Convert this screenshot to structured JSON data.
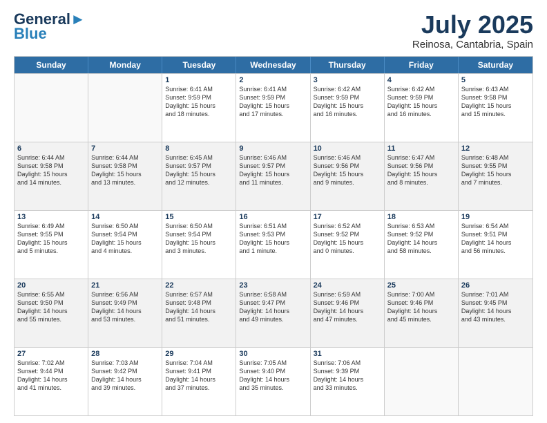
{
  "logo": {
    "line1": "General",
    "line2": "Blue"
  },
  "title": "July 2025",
  "location": "Reinosa, Cantabria, Spain",
  "weekdays": [
    "Sunday",
    "Monday",
    "Tuesday",
    "Wednesday",
    "Thursday",
    "Friday",
    "Saturday"
  ],
  "weeks": [
    [
      {
        "day": "",
        "info": "",
        "empty": true
      },
      {
        "day": "",
        "info": "",
        "empty": true
      },
      {
        "day": "1",
        "info": "Sunrise: 6:41 AM\nSunset: 9:59 PM\nDaylight: 15 hours\nand 18 minutes."
      },
      {
        "day": "2",
        "info": "Sunrise: 6:41 AM\nSunset: 9:59 PM\nDaylight: 15 hours\nand 17 minutes."
      },
      {
        "day": "3",
        "info": "Sunrise: 6:42 AM\nSunset: 9:59 PM\nDaylight: 15 hours\nand 16 minutes."
      },
      {
        "day": "4",
        "info": "Sunrise: 6:42 AM\nSunset: 9:59 PM\nDaylight: 15 hours\nand 16 minutes."
      },
      {
        "day": "5",
        "info": "Sunrise: 6:43 AM\nSunset: 9:58 PM\nDaylight: 15 hours\nand 15 minutes."
      }
    ],
    [
      {
        "day": "6",
        "info": "Sunrise: 6:44 AM\nSunset: 9:58 PM\nDaylight: 15 hours\nand 14 minutes."
      },
      {
        "day": "7",
        "info": "Sunrise: 6:44 AM\nSunset: 9:58 PM\nDaylight: 15 hours\nand 13 minutes."
      },
      {
        "day": "8",
        "info": "Sunrise: 6:45 AM\nSunset: 9:57 PM\nDaylight: 15 hours\nand 12 minutes."
      },
      {
        "day": "9",
        "info": "Sunrise: 6:46 AM\nSunset: 9:57 PM\nDaylight: 15 hours\nand 11 minutes."
      },
      {
        "day": "10",
        "info": "Sunrise: 6:46 AM\nSunset: 9:56 PM\nDaylight: 15 hours\nand 9 minutes."
      },
      {
        "day": "11",
        "info": "Sunrise: 6:47 AM\nSunset: 9:56 PM\nDaylight: 15 hours\nand 8 minutes."
      },
      {
        "day": "12",
        "info": "Sunrise: 6:48 AM\nSunset: 9:55 PM\nDaylight: 15 hours\nand 7 minutes."
      }
    ],
    [
      {
        "day": "13",
        "info": "Sunrise: 6:49 AM\nSunset: 9:55 PM\nDaylight: 15 hours\nand 5 minutes."
      },
      {
        "day": "14",
        "info": "Sunrise: 6:50 AM\nSunset: 9:54 PM\nDaylight: 15 hours\nand 4 minutes."
      },
      {
        "day": "15",
        "info": "Sunrise: 6:50 AM\nSunset: 9:54 PM\nDaylight: 15 hours\nand 3 minutes."
      },
      {
        "day": "16",
        "info": "Sunrise: 6:51 AM\nSunset: 9:53 PM\nDaylight: 15 hours\nand 1 minute."
      },
      {
        "day": "17",
        "info": "Sunrise: 6:52 AM\nSunset: 9:52 PM\nDaylight: 15 hours\nand 0 minutes."
      },
      {
        "day": "18",
        "info": "Sunrise: 6:53 AM\nSunset: 9:52 PM\nDaylight: 14 hours\nand 58 minutes."
      },
      {
        "day": "19",
        "info": "Sunrise: 6:54 AM\nSunset: 9:51 PM\nDaylight: 14 hours\nand 56 minutes."
      }
    ],
    [
      {
        "day": "20",
        "info": "Sunrise: 6:55 AM\nSunset: 9:50 PM\nDaylight: 14 hours\nand 55 minutes."
      },
      {
        "day": "21",
        "info": "Sunrise: 6:56 AM\nSunset: 9:49 PM\nDaylight: 14 hours\nand 53 minutes."
      },
      {
        "day": "22",
        "info": "Sunrise: 6:57 AM\nSunset: 9:48 PM\nDaylight: 14 hours\nand 51 minutes."
      },
      {
        "day": "23",
        "info": "Sunrise: 6:58 AM\nSunset: 9:47 PM\nDaylight: 14 hours\nand 49 minutes."
      },
      {
        "day": "24",
        "info": "Sunrise: 6:59 AM\nSunset: 9:46 PM\nDaylight: 14 hours\nand 47 minutes."
      },
      {
        "day": "25",
        "info": "Sunrise: 7:00 AM\nSunset: 9:46 PM\nDaylight: 14 hours\nand 45 minutes."
      },
      {
        "day": "26",
        "info": "Sunrise: 7:01 AM\nSunset: 9:45 PM\nDaylight: 14 hours\nand 43 minutes."
      }
    ],
    [
      {
        "day": "27",
        "info": "Sunrise: 7:02 AM\nSunset: 9:44 PM\nDaylight: 14 hours\nand 41 minutes."
      },
      {
        "day": "28",
        "info": "Sunrise: 7:03 AM\nSunset: 9:42 PM\nDaylight: 14 hours\nand 39 minutes."
      },
      {
        "day": "29",
        "info": "Sunrise: 7:04 AM\nSunset: 9:41 PM\nDaylight: 14 hours\nand 37 minutes."
      },
      {
        "day": "30",
        "info": "Sunrise: 7:05 AM\nSunset: 9:40 PM\nDaylight: 14 hours\nand 35 minutes."
      },
      {
        "day": "31",
        "info": "Sunrise: 7:06 AM\nSunset: 9:39 PM\nDaylight: 14 hours\nand 33 minutes."
      },
      {
        "day": "",
        "info": "",
        "empty": true
      },
      {
        "day": "",
        "info": "",
        "empty": true
      }
    ]
  ]
}
